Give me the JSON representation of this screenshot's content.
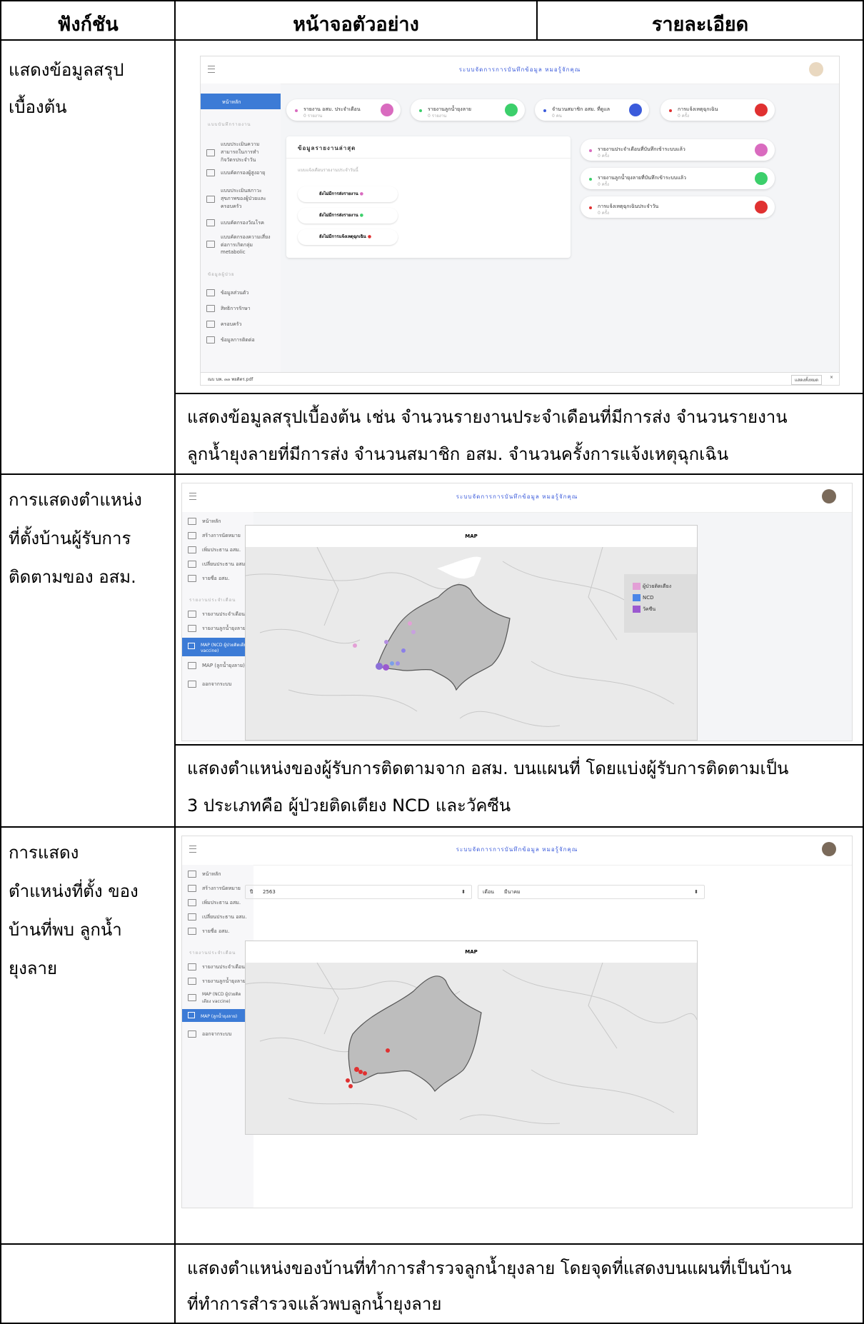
{
  "table": {
    "headers": [
      "ฟังก์ชัน",
      "หน้าจอตัวอย่าง",
      "รายละเอียด"
    ],
    "rows": [
      {
        "function_lines": [
          "แสดงข้อมูลสรุป",
          "เบื้องต้น"
        ],
        "description_lines": [
          "แสดงข้อมูลสรุปเบื้องต้น เช่น จำนวนรายงานประจำเดือนที่มีการส่ง จำนวนรายงาน",
          "ลูกน้ำยุงลายที่มีการส่ง จำนวนสมาชิก อสม. จำนวนครั้งการแจ้งเหตุฉุกเฉิน"
        ]
      },
      {
        "function_lines": [
          "การแสดงตำแหน่ง",
          "ที่ตั้งบ้านผู้รับการ",
          "ติดตามของ อสม."
        ],
        "description_lines": [
          "แสดงตำแหน่งของผู้รับการติดตามจาก   อสม. บนแผนที่ โดยแบ่งผู้รับการติดตามเป็น",
          "3 ประเภทคือ ผู้ป่วยติดเตียง NCD และวัคซีน"
        ]
      },
      {
        "function_lines": [
          "การแสดง",
          "ตำแหน่งที่ตั้ง ของ",
          "บ้านที่พบ ลูกน้ำ",
          "ยุงลาย"
        ],
        "description_lines": [
          "แสดงตำแหน่งของบ้านที่ทำการสำรวจลูกน้ำยุงลาย โดยจุดที่แสดงบนแผนที่เป็นบ้าน",
          "ที่ทำการสำรวจแล้วพบลูกน้ำยุงลาย"
        ]
      }
    ]
  },
  "shot1": {
    "title": "ระบบจัดการการบันทึกข้อมูล หมอรู้จักคุณ",
    "active_item": "หน้าหลัก",
    "section1": "แบบบันทึกรายงาน",
    "menu1": [
      "แบบประเมินความสามารถในการทำกิจวัตรประจำวัน",
      "แบบคัดกรองผู้สูงอายุ",
      "แบบประเมินสภาวะสุขภาพของผู้ป่วยและครอบครัว",
      "แบบคัดกรองวัณโรค",
      "แบบคัดกรองความเสี่ยงต่อการเกิดกลุ่ม metabolic"
    ],
    "section2": "ข้อมูลผู้ป่วย",
    "menu2": [
      "ข้อมูลส่วนตัว",
      "สิทธิการรักษา",
      "ครอบครัว",
      "ข้อมูลการติดต่อ"
    ],
    "cards": [
      {
        "label": "รายงาน อสม. ประจำเดือน",
        "sub": "0 รายงาน",
        "color": "#d96bbf"
      },
      {
        "label": "รายงานลูกน้ำยุงลาย",
        "sub": "0 รายงาน",
        "color": "#3ccf6b"
      },
      {
        "label": "จำนวนสมาชิก อสม. ที่ดูแล",
        "sub": "0 คน",
        "color": "#3b5bdb"
      },
      {
        "label": "การแจ้งเหตุฉุกเฉิน",
        "sub": "0 ครั้ง",
        "color": "#e03131"
      }
    ],
    "latest_title": "ข้อมูลรายงานล่าสุด",
    "latest_sub": "แบบแจ้งเตือนรายงานประจำวันนี้",
    "latest_items": [
      "ยังไม่มีการส่งรายงาน",
      "ยังไม่มีการส่งรายงาน",
      "ยังไม่มีการแจ้งเหตุฉุกเฉิน"
    ],
    "right_cards": [
      {
        "label": "รายงานประจำเดือนที่บันทึกเข้าระบบแล้ว",
        "sub": "0 ครั้ง",
        "color": "#d96bbf"
      },
      {
        "label": "รายงานลูกน้ำยุงลายที่บันทึกเข้าระบบแล้ว",
        "sub": "0 ครั้ง",
        "color": "#3ccf6b"
      },
      {
        "label": "การแจ้งเหตุฉุกเฉินประจำวัน",
        "sub": "0 ครั้ง",
        "color": "#e03131"
      }
    ],
    "download_bar": "ณบ นพ. ๓๓ พยดิตร.pdf",
    "download_btn": "แสดงทั้งหมด"
  },
  "shot2": {
    "title": "ระบบจัดการการบันทึกข้อมูล หมอรู้จักคุณ",
    "menu": [
      "หน้าหลัก",
      "สร้างการนัดหมาย",
      "เพิ่มประธาน อสม.",
      "เปลี่ยนประธาน อสม.",
      "รายชื่อ อสม."
    ],
    "section": "รายงานประจำเดือน",
    "menu2": [
      "รายงานประจำเดือน",
      "รายงานลูกน้ำยุงลาย"
    ],
    "active": "MAP (NCD ผู้ป่วยติดเตียง vaccine)",
    "menu3": [
      "MAP (ลูกน้ำยุงลาย)",
      "ออกจากระบบ"
    ],
    "map_title": "MAP",
    "legend": [
      {
        "name": "ผู้ป่วยติดเตียง",
        "color": "#e3a0d6"
      },
      {
        "name": "NCD",
        "color": "#4a86e8"
      },
      {
        "name": "วัคซีน",
        "color": "#9b59d0"
      }
    ]
  },
  "shot3": {
    "title": "ระบบจัดการการบันทึกข้อมูล หมอรู้จักคุณ",
    "menu": [
      "หน้าหลัก",
      "สร้างการนัดหมาย",
      "เพิ่มประธาน อสม.",
      "เปลี่ยนประธาน อสม.",
      "รายชื่อ อสม."
    ],
    "section": "รายงานประจำเดือน",
    "menu2": [
      "รายงานประจำเดือน",
      "รายงานลูกน้ำยุงลาย",
      "MAP (NCD ผู้ป่วยติดเตียง vaccine)"
    ],
    "active": "MAP (ลูกน้ำยุงลาย)",
    "menu3": [
      "ออกจากระบบ"
    ],
    "year_label": "ปี",
    "year_value": "2563",
    "month_label": "เดือน",
    "month_value": "มีนาคม",
    "map_title": "MAP"
  }
}
